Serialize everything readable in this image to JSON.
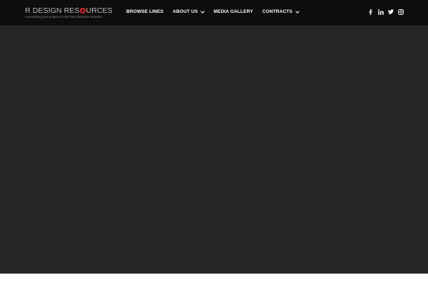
{
  "brand": {
    "name_part1": "R DESIGN RES",
    "name_part2": "URCES",
    "logo_mark_color": "#d8232a",
    "tagline": "connecting your project to the best furniture solution"
  },
  "nav": {
    "items": [
      {
        "label": "BROWSE LINES",
        "has_dropdown": false
      },
      {
        "label": "ABOUT US",
        "has_dropdown": true
      },
      {
        "label": "MEDIA GALLERY",
        "has_dropdown": false
      },
      {
        "label": "CONTRACTS",
        "has_dropdown": true
      }
    ]
  },
  "social": [
    "facebook-icon",
    "linkedin-icon",
    "twitter-icon",
    "instagram-icon"
  ],
  "colors": {
    "header_bg": "#0d0d0d",
    "hero_bg": "#262626",
    "text": "#ffffff"
  }
}
